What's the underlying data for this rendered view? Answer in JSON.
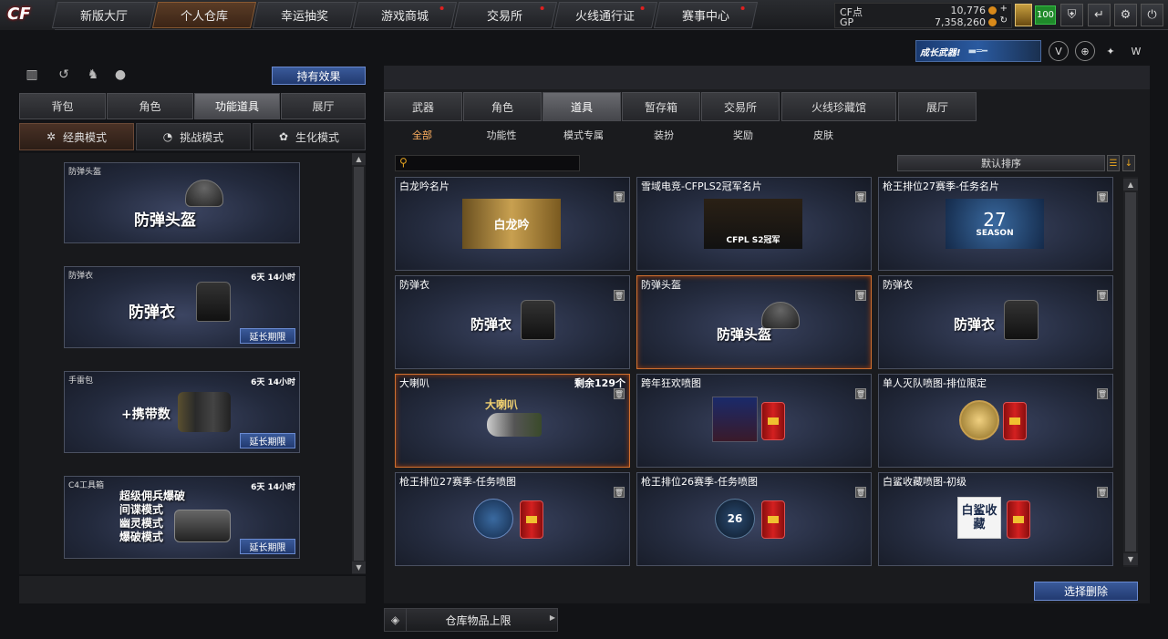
{
  "nav": {
    "logo": "CF",
    "tabs": [
      {
        "label": "新版大厅"
      },
      {
        "label": "个人仓库"
      },
      {
        "label": "幸运抽奖"
      },
      {
        "label": "游戏商城"
      },
      {
        "label": "交易所"
      },
      {
        "label": "火线通行证"
      },
      {
        "label": "赛事中心"
      }
    ],
    "active_tab": "个人仓库"
  },
  "currency": {
    "cf_label": "CF点",
    "cf_value": "10,776",
    "gp_label": "GP",
    "gp_value": "7,358,260",
    "level": "100"
  },
  "promo": {
    "text": "成长武器!"
  },
  "left": {
    "effect_button": "持有效果",
    "tabs": [
      "背包",
      "角色",
      "功能道具",
      "展厅"
    ],
    "active_tab": "功能道具",
    "modes": [
      "经典模式",
      "挑战模式",
      "生化模式"
    ],
    "active_mode": "经典模式",
    "items": [
      {
        "title": "防弹头盔",
        "time": "",
        "big": "防弹头盔",
        "extend": ""
      },
      {
        "title": "防弹衣",
        "time": "6天 14小时",
        "big": "防弹衣",
        "extend": "延长期限"
      },
      {
        "title": "手雷包",
        "time": "6天 14小时",
        "big": "+携带数",
        "extend": "延长期限"
      },
      {
        "title": "C4工具箱",
        "time": "6天 14小时",
        "big": "",
        "extend": "延长期限",
        "lines": [
          "超级佣兵爆破",
          "间谍模式",
          "幽灵模式",
          "爆破模式"
        ]
      }
    ]
  },
  "right": {
    "tabs": [
      "武器",
      "角色",
      "道具",
      "暂存箱",
      "交易所",
      "火线珍藏馆",
      "展厅"
    ],
    "active_tab": "道具",
    "subtabs": [
      "全部",
      "功能性",
      "模式专属",
      "装扮",
      "奖励",
      "皮肤"
    ],
    "active_subtab": "全部",
    "sort_label": "默认排序",
    "items": [
      {
        "title": "白龙吟名片",
        "count": "",
        "image_text": "白龙吟"
      },
      {
        "title": "雪域电竞-CFPLS2冠军名片",
        "count": "",
        "image_text": "CFPL S2冠军"
      },
      {
        "title": "枪王排位27赛季-任务名片",
        "count": "",
        "image_text": "27",
        "image_sub": "SEASON"
      },
      {
        "title": "防弹衣",
        "count": "",
        "image_text": "防弹衣"
      },
      {
        "title": "防弹头盔",
        "count": "",
        "image_text": "防弹头盔"
      },
      {
        "title": "防弹衣",
        "count": "",
        "image_text": "防弹衣"
      },
      {
        "title": "大喇叭",
        "count": "剩余129个",
        "image_text": "大喇叭"
      },
      {
        "title": "跨年狂欢喷图",
        "count": "",
        "image_text": ""
      },
      {
        "title": "单人灭队喷图-排位限定",
        "count": "",
        "image_text": ""
      },
      {
        "title": "枪王排位27赛季-任务喷图",
        "count": "",
        "image_text": ""
      },
      {
        "title": "枪王排位26赛季-任务喷图",
        "count": "",
        "image_text": "26"
      },
      {
        "title": "白鲨收藏喷图-初级",
        "count": "",
        "image_text": "白鲨收藏"
      }
    ],
    "delete_button": "选择删除",
    "capacity_label": "仓库物品上限"
  }
}
